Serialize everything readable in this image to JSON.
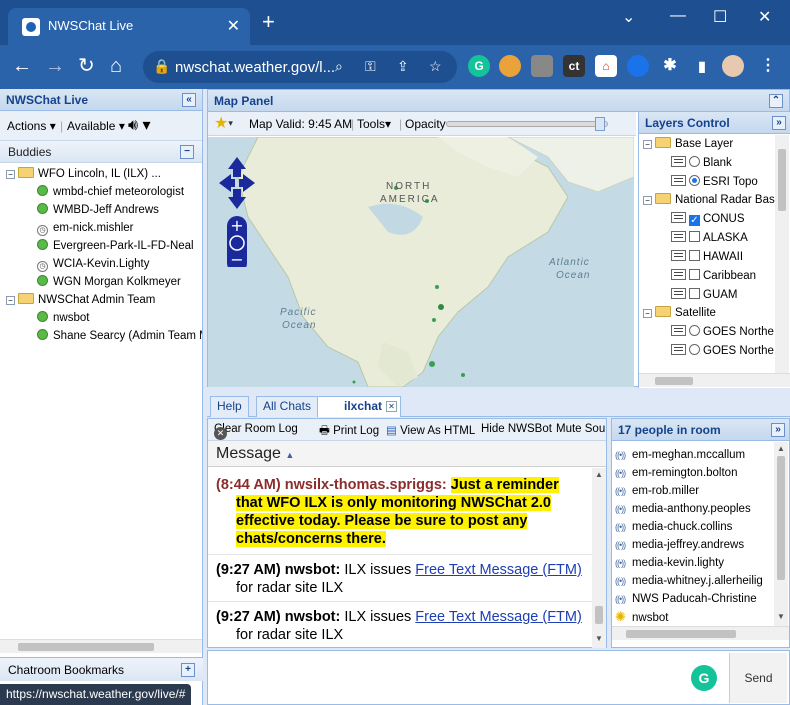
{
  "browser": {
    "tab_title": "NWSChat Live",
    "url": "nwschat.weather.gov/l...",
    "status_url": "https://nwschat.weather.gov/live/#",
    "extensions": [
      "G",
      "ct"
    ]
  },
  "left": {
    "title": "NWSChat Live",
    "actions_label": "Actions",
    "status_label": "Available",
    "buddies_label": "Buddies",
    "groups": [
      {
        "name": "WFO Lincoln, IL (ILX) ...",
        "members": [
          {
            "name": "wmbd-chief meteorologist",
            "status": "available"
          },
          {
            "name": "WMBD-Jeff Andrews",
            "status": "available"
          },
          {
            "name": "em-nick.mishler",
            "status": "idle"
          },
          {
            "name": "Evergreen-Park-IL-FD-Neal",
            "status": "available"
          },
          {
            "name": "WCIA-Kevin.Lighty",
            "status": "idle"
          },
          {
            "name": "WGN Morgan Kolkmeyer",
            "status": "available"
          }
        ]
      },
      {
        "name": "NWSChat Admin Team",
        "members": [
          {
            "name": "nwsbot",
            "status": "available"
          },
          {
            "name": "Shane Searcy (Admin Team M",
            "status": "available"
          }
        ]
      }
    ],
    "bookmarks_label": "Chatroom Bookmarks"
  },
  "map": {
    "title": "Map Panel",
    "valid_label": "Map Valid: 9:45 AM",
    "tools_label": "Tools",
    "opacity_label": "Opacity",
    "opacity": 0.92,
    "labels": {
      "north": "NORTH",
      "america": "AMERICA",
      "atlantic": "Atlantic",
      "ocean": "Ocean",
      "pacific": "Pacific",
      "ocean2": "Ocean"
    }
  },
  "layers": {
    "title": "Layers Control",
    "items": [
      {
        "type": "folder",
        "label": "Base Layer"
      },
      {
        "type": "radio",
        "label": "Blank",
        "checked": false
      },
      {
        "type": "radio",
        "label": "ESRI Topo",
        "checked": true
      },
      {
        "type": "folder",
        "label": "National Radar Base"
      },
      {
        "type": "check",
        "label": "CONUS",
        "checked": true
      },
      {
        "type": "check",
        "label": "ALASKA",
        "checked": false
      },
      {
        "type": "check",
        "label": "HAWAII",
        "checked": false
      },
      {
        "type": "check",
        "label": "Caribbean",
        "checked": false
      },
      {
        "type": "check",
        "label": "GUAM",
        "checked": false
      },
      {
        "type": "folder",
        "label": "Satellite"
      },
      {
        "type": "radio",
        "label": "GOES Northe",
        "checked": false
      },
      {
        "type": "radio",
        "label": "GOES Northe",
        "checked": false
      }
    ]
  },
  "chat": {
    "tabs": [
      "Help",
      "All Chats",
      "ilxchat"
    ],
    "active_tab": "ilxchat",
    "toolbar": {
      "clear": "Clear Room Log",
      "print": "Print Log",
      "view_html": "View As HTML",
      "hide_bot": "Hide NWSBot",
      "mute": "Mute Sour"
    },
    "message_header": "Message",
    "messages": [
      {
        "time": "(8:44 AM)",
        "sender": "nwsilx-thomas.spriggs:",
        "text": "Just a reminder that WFO ILX is only monitoring NWSChat 2.0 effective today. Please be sure to post any chats/concerns there.",
        "highlight": true,
        "sender_color": "#8b2d2d"
      },
      {
        "time": "(9:27 AM)",
        "sender": "nwsbot:",
        "pre": "ILX issues ",
        "link": "Free Text Message (FTM)",
        "post": " for radar site ILX",
        "highlight": false
      },
      {
        "time": "(9:27 AM)",
        "sender": "nwsbot:",
        "pre": "ILX issues ",
        "link": "Free Text Message (FTM)",
        "post": " for radar site ILX",
        "highlight": false
      }
    ],
    "send_label": "Send",
    "input_value": ""
  },
  "roster": {
    "title": "17 people in room",
    "people": [
      "em-meghan.mccallum",
      "em-remington.bolton",
      "em-rob.miller",
      "media-anthony.peoples",
      "media-chuck.collins",
      "media-jeffrey.andrews",
      "media-kevin.lighty",
      "media-whitney.j.allerheilig",
      "NWS Paducah-Christine",
      "nwsbot"
    ]
  }
}
